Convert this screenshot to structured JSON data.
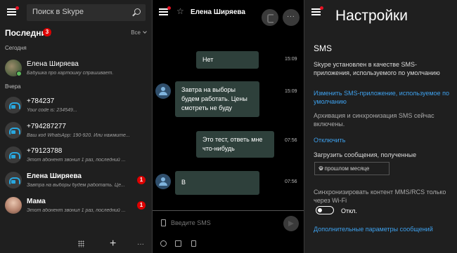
{
  "left": {
    "search_placeholder": "Поиск в Skype",
    "recent_title": "Последние",
    "recent_badge": "3",
    "filter": "Все",
    "section_today": "Сегодня",
    "section_yesterday": "Вчера",
    "conversations": [
      {
        "name": "Елена Ширяева",
        "preview": "Бабушка про картошку спрашивает.",
        "bold": false,
        "badge": ""
      },
      {
        "name": "+784237",
        "preview": "Your code is: 234549...",
        "bold": false,
        "badge": ""
      },
      {
        "name": "+794287277",
        "preview": "Ваш код WhatsApp: 190-920. Или нажмите...",
        "bold": false,
        "badge": ""
      },
      {
        "name": "+79123788",
        "preview": "Этот абонент звонил 1 раз, последний ...",
        "bold": false,
        "badge": ""
      },
      {
        "name": "Елена Ширяева",
        "preview": "Завтра на выборы будем работать. Це...",
        "bold": true,
        "badge": "1"
      },
      {
        "name": "Мама",
        "preview": "Этот абонент звонил 1 раз, последний ...",
        "bold": true,
        "badge": "1"
      }
    ],
    "bottom_more": "···"
  },
  "chat": {
    "contact_name": "Елена Ширяева",
    "more_label": "···",
    "messages": [
      {
        "text": "Нет",
        "time": "15:09",
        "dir": "out"
      },
      {
        "text": "Завтра на выборы будем работать. Цены смотреть не буду",
        "time": "15:09",
        "dir": "in"
      },
      {
        "text": "Это тест, ответь мне что-нибудь",
        "time": "07:56",
        "dir": "out"
      },
      {
        "text": "В",
        "time": "07:56",
        "dir": "in"
      }
    ],
    "input_placeholder": "Введите SMS"
  },
  "settings": {
    "title": "Настройки",
    "sms_heading": "SMS",
    "status_text": "Skype установлен в качестве SMS-приложения, используемого по умолчанию",
    "change_link": "Изменить SMS-приложение, используемое по умолчанию",
    "archive_text": "Архивация и синхронизация SMS сейчас включены.",
    "disable_link": "Отключить",
    "load_label": "Загрузить сообщения, полученные",
    "dropdown_value": "В прошлом месяце",
    "sync_label": "Синхронизировать контент MMS/RCS только через Wi-Fi",
    "toggle_label": "Откл.",
    "advanced_link": "Дополнительные параметры сообщений"
  },
  "colors": {
    "accent_link": "#3ea1ee",
    "badge_red": "#dd0000",
    "bubble": "#2e403b",
    "online": "#5cb85c"
  }
}
